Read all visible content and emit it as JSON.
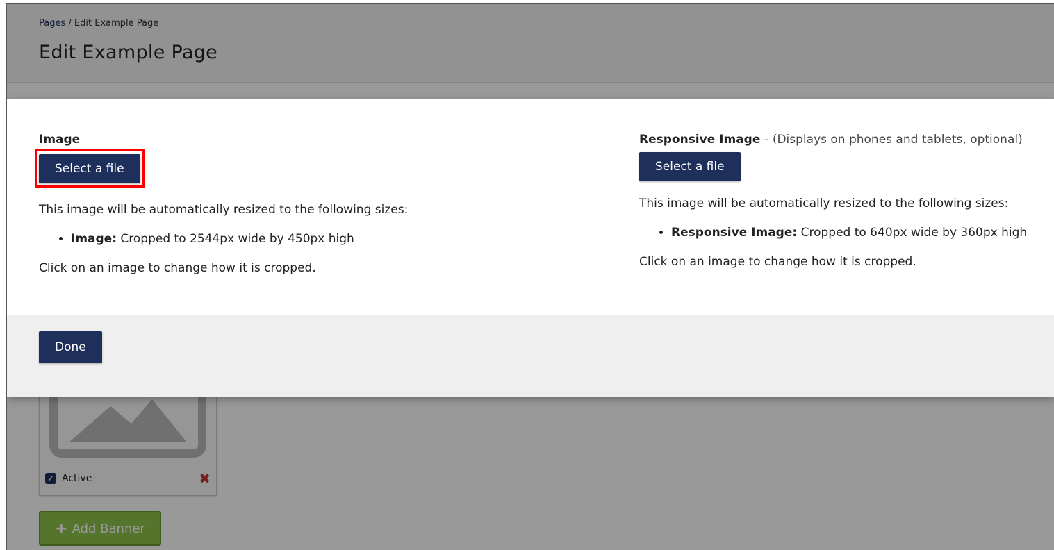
{
  "breadcrumb": {
    "link": "Pages",
    "separator": "/",
    "current": "Edit Example Page"
  },
  "page_title": "Edit Example Page",
  "modal": {
    "left": {
      "label": "Image",
      "button": "Select a file",
      "description": "This image will be automatically resized to the following sizes:",
      "bullet_label": "Image:",
      "bullet_text": "Cropped to 2544px wide by 450px high",
      "crop_note": "Click on an image to change how it is cropped."
    },
    "right": {
      "label": "Responsive Image",
      "note": "- (Displays on phones and tablets, optional)",
      "button": "Select a file",
      "description": "This image will be automatically resized to the following sizes:",
      "bullet_label": "Responsive Image:",
      "bullet_text": "Cropped to 640px wide by 360px high",
      "crop_note": "Click on an image to change how it is cropped."
    },
    "done_button": "Done"
  },
  "banner_card": {
    "active_label": "Active",
    "active_checked": true,
    "icons": {
      "placeholder": "image-placeholder-icon",
      "checkbox": "checkbox-checked-icon",
      "remove": "close-icon"
    }
  },
  "add_banner_button": {
    "label": "Add Banner",
    "icon": "plus-icon"
  },
  "colors": {
    "primary": "#1f2f5c",
    "highlight": "#ff0000",
    "add_button": "#8fc44a",
    "remove": "#c0392b"
  }
}
